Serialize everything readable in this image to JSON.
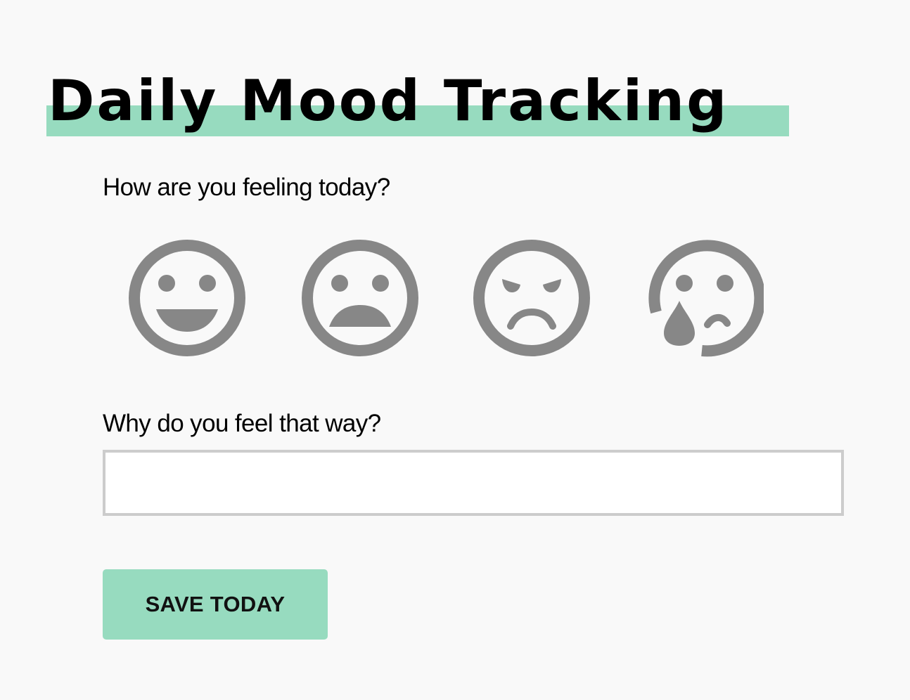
{
  "header": {
    "title": "Daily Mood Tracking"
  },
  "mood": {
    "question": "How are you feeling today?",
    "options": [
      {
        "icon": "happy-face-icon"
      },
      {
        "icon": "sad-face-icon"
      },
      {
        "icon": "angry-face-icon"
      },
      {
        "icon": "crying-face-icon"
      }
    ]
  },
  "reason": {
    "question": "Why do you feel that way?",
    "value": "",
    "placeholder": ""
  },
  "save_button": {
    "label": "SAVE TODAY"
  },
  "colors": {
    "accent": "#97dbbf",
    "icon": "#878787",
    "background": "#f9f9f9",
    "input_border": "#cccccc"
  }
}
